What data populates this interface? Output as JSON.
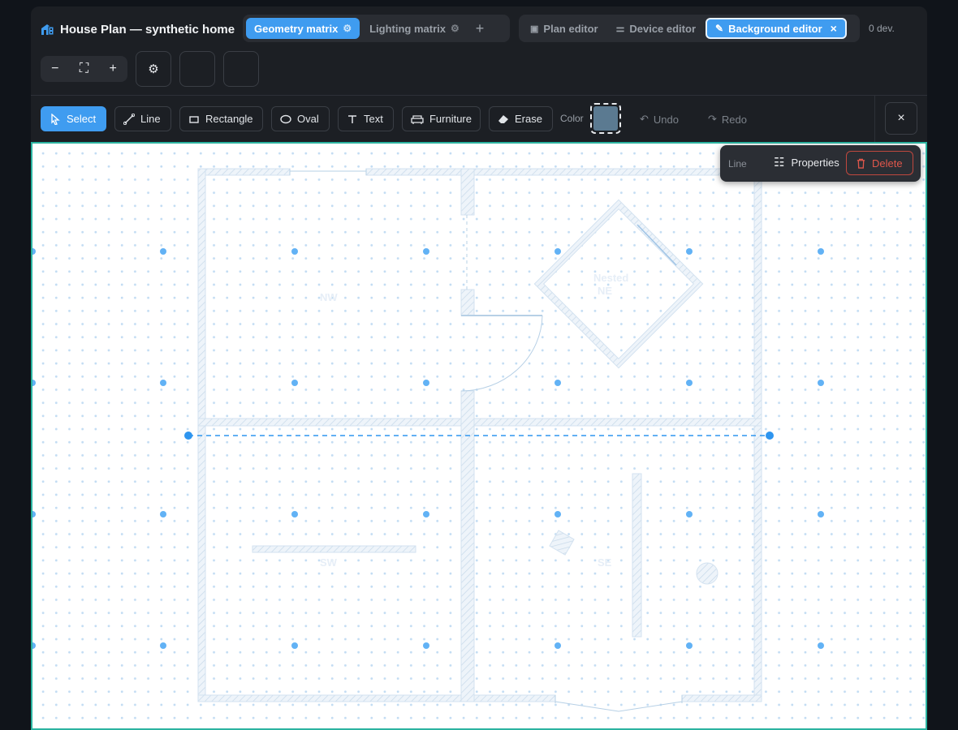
{
  "header": {
    "title": "House Plan — synthetic home",
    "matrix_tabs": [
      {
        "label": "Geometry matrix",
        "active": true
      },
      {
        "label": "Lighting matrix",
        "active": false
      }
    ],
    "add_tab": "+",
    "editor_tabs": [
      {
        "label": "Plan editor"
      },
      {
        "label": "Device editor"
      },
      {
        "label": "Background editor",
        "active": true,
        "close": "×"
      }
    ],
    "device_count": "0 dev."
  },
  "zoom": {
    "minus": "−",
    "plus": "+"
  },
  "toolbar": {
    "tools": [
      {
        "label": "Select",
        "active": true
      },
      {
        "label": "Line"
      },
      {
        "label": "Rectangle"
      },
      {
        "label": "Oval"
      },
      {
        "label": "Text"
      },
      {
        "label": "Furniture"
      },
      {
        "label": "Erase"
      }
    ],
    "color_label": "Color",
    "color_value": "#5b7a91",
    "undo": "Undo",
    "redo": "Redo",
    "close": "×"
  },
  "selection_popup": {
    "kind": "Line",
    "properties": "Properties",
    "delete": "Delete"
  },
  "rooms": [
    {
      "label": "NW"
    },
    {
      "label": "Nested NE"
    },
    {
      "label": "SW"
    },
    {
      "label": "SE"
    }
  ],
  "colors": {
    "accent": "#3f9cf0",
    "canvas_border": "#2bb3a0",
    "delete": "#e0574b",
    "wall_stroke": "#c9daea"
  }
}
